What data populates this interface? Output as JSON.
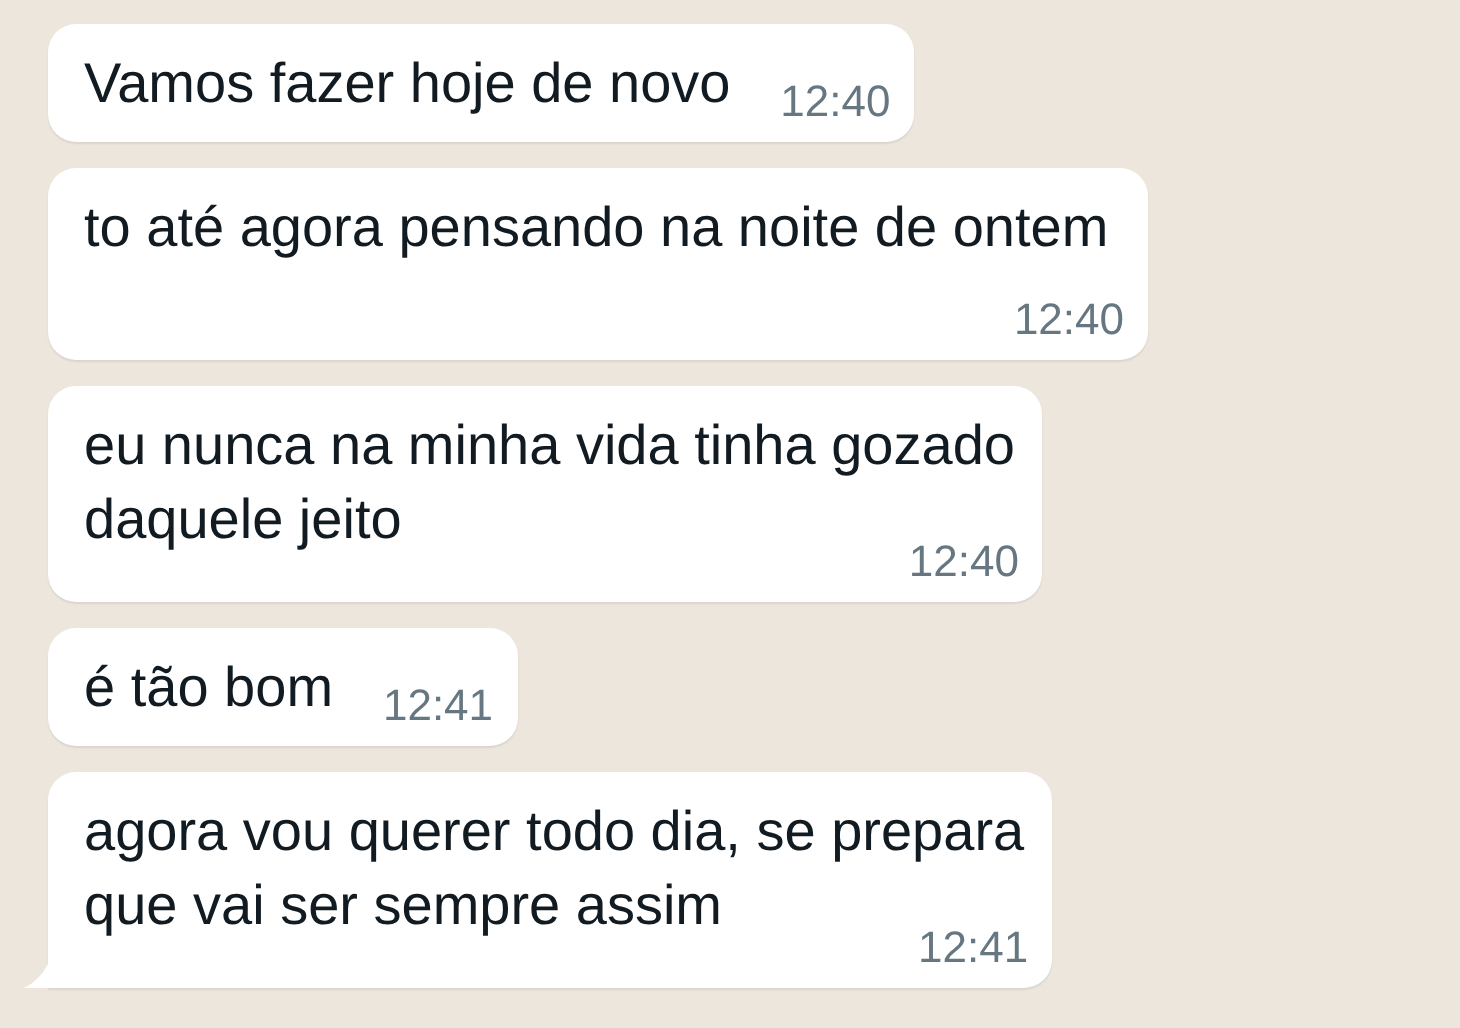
{
  "messages": [
    {
      "lines": [
        "Vamos fazer hoje de novo"
      ],
      "time": "12:40",
      "tail": false
    },
    {
      "lines": [
        "to até agora pensando na noite de ontem"
      ],
      "time": "12:40",
      "tail": false
    },
    {
      "lines": [
        "eu nunca na minha vida tinha gozado",
        "daquele jeito"
      ],
      "time": "12:40",
      "tail": false
    },
    {
      "lines": [
        "é tão bom"
      ],
      "time": "12:41",
      "tail": false
    },
    {
      "lines": [
        "agora vou querer todo dia, se prepara",
        "que vai ser sempre assim"
      ],
      "time": "12:41",
      "tail": true
    }
  ]
}
